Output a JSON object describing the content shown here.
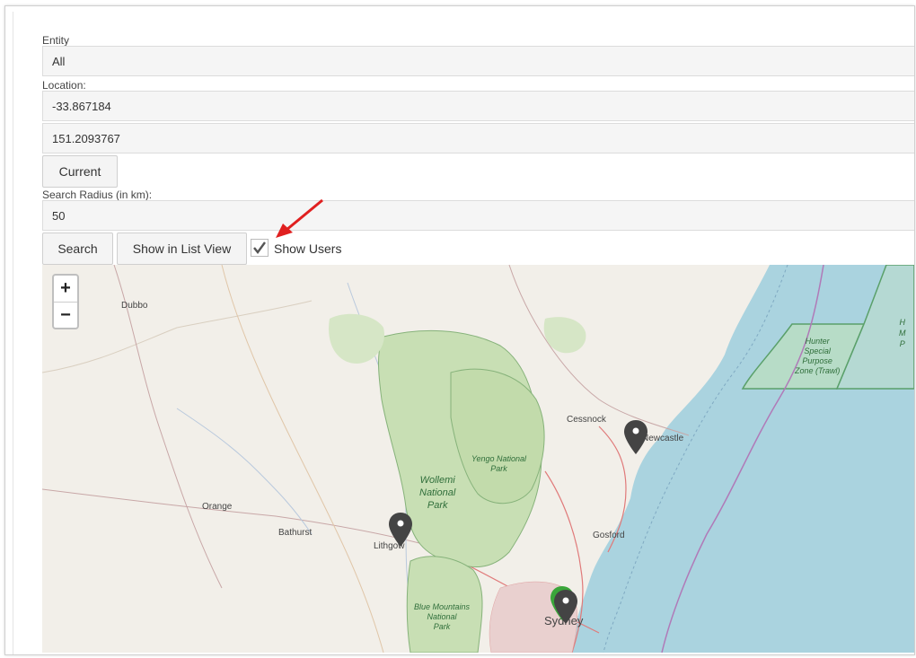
{
  "form": {
    "entity_label": "Entity",
    "entity_value": "All",
    "location_label": "Location:",
    "latitude": "-33.867184",
    "longitude": "151.2093767",
    "current_button": "Current",
    "radius_label": "Search Radius (in km):",
    "radius_value": "50",
    "search_button": "Search",
    "list_view_button": "Show in List View",
    "show_users_label": "Show Users",
    "show_users_checked": true
  },
  "map": {
    "zoom_in": "+",
    "zoom_out": "−",
    "places": {
      "dubbo": "Dubbo",
      "orange": "Orange",
      "bathurst": "Bathurst",
      "lithgow": "Lithgow",
      "cessnock": "Cessnock",
      "newcastle": "Newcastle",
      "gosford": "Gosford",
      "sydney": "Sydney"
    },
    "parks": {
      "wollemi_1": "Wollemi",
      "wollemi_2": "National",
      "wollemi_3": "Park",
      "yengo_1": "Yengo National",
      "yengo_2": "Park",
      "blue_1": "Blue Mountains",
      "blue_2": "National",
      "blue_3": "Park",
      "hunter_1": "Hunter",
      "hunter_2": "Special",
      "hunter_3": "Purpose",
      "hunter_4": "Zone (Trawl)",
      "edge_1": "H",
      "edge_2": "M",
      "edge_3": "P"
    },
    "colors": {
      "land": "#f2efe9",
      "sea": "#aad3df",
      "park": "#c8dfb4",
      "pin": "#444444",
      "pin_user": "#3aa63a",
      "annotation": "#e02020"
    }
  }
}
